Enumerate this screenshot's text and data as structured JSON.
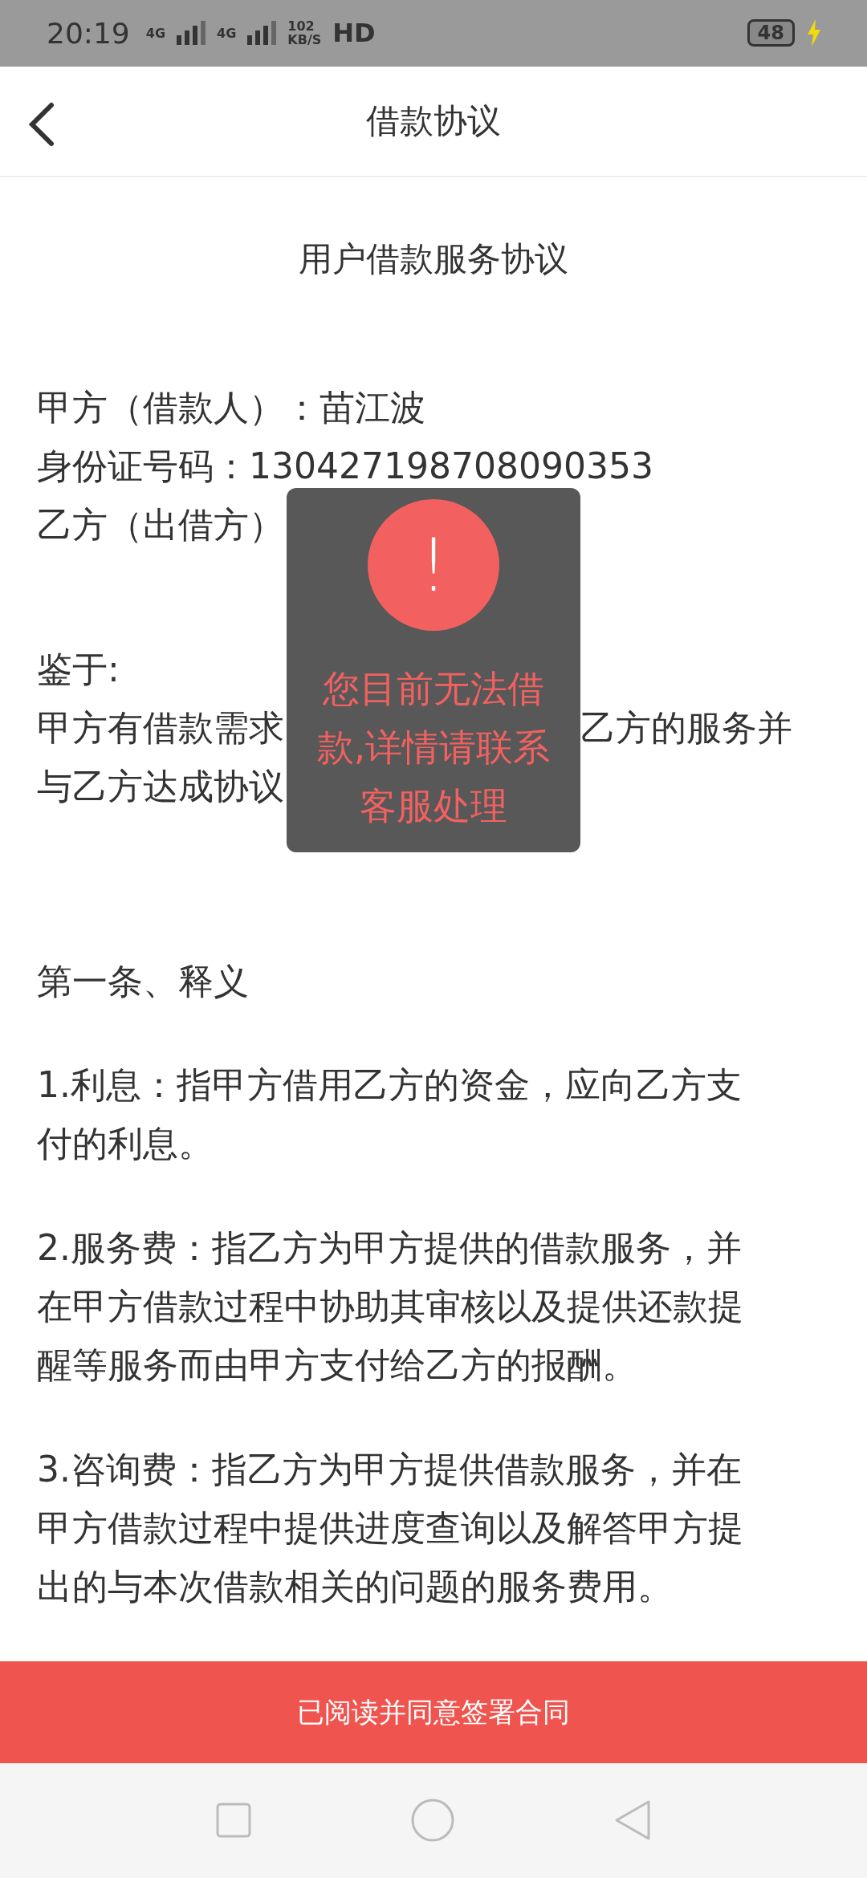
{
  "status_bar": {
    "time": "20:19",
    "net1": "4G",
    "net2": "4G",
    "speed_value": "102",
    "speed_unit": "KB/S",
    "hd": "HD",
    "battery": "48",
    "charging": true
  },
  "header": {
    "title": "借款协议"
  },
  "document": {
    "title": "用户借款服务协议",
    "parties": [
      [
        "甲方（借款人）：苗江波"
      ],
      [
        "身份证号码：130427198708090353"
      ],
      [
        "乙方（出借方）"
      ]
    ],
    "recitals": [
      [
        "鉴于:"
      ],
      [
        "甲方有借款需求",
        "乙方的服务并"
      ],
      [
        "与乙方达成协议"
      ]
    ],
    "article": {
      "heading": "第一条、释义",
      "clauses": [
        [
          "1.利息：指甲方借用乙方的资金，应向乙方支",
          "付的利息。"
        ],
        [
          "2.服务费：指乙方为甲方提供的借款服务，并",
          "在甲方借款过程中协助其审核以及提供还款提",
          "醒等服务而由甲方支付给乙方的报酬。"
        ],
        [
          "3.咨询费：指乙方为甲方提供借款服务，并在",
          "甲方借款过程中提供进度查询以及解答甲方提",
          "出的与本次借款相关的问题的服务费用。"
        ]
      ]
    }
  },
  "toast": {
    "icon": "!",
    "message": "您目前无法借款,详情请联系客服处理"
  },
  "agree_button": {
    "label": "已阅读并同意签署合同"
  }
}
